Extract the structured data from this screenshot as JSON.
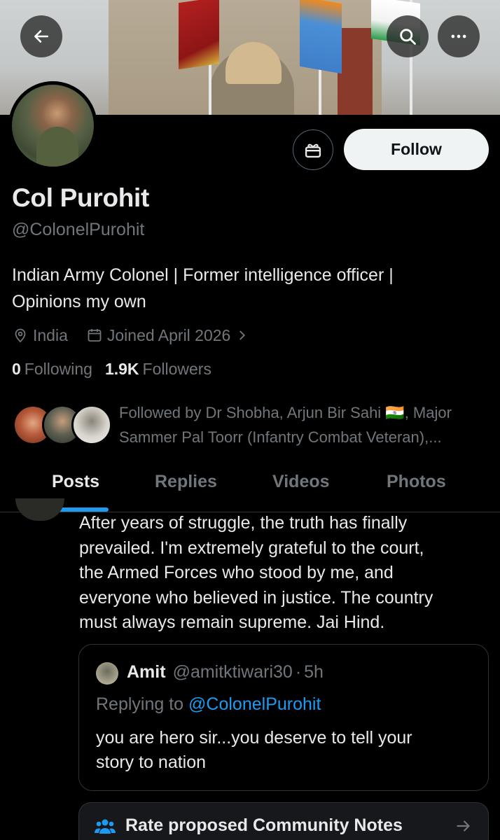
{
  "header": {
    "back_icon": "arrow-left-icon",
    "search_icon": "search-icon",
    "more_icon": "more-horizontal-icon"
  },
  "profile": {
    "name": "Col Purohit",
    "handle": "@ColonelPurohit",
    "bio_line1": "Indian Army Colonel | Former intelligence officer |",
    "bio_line2": "Opinions my own",
    "location": "India",
    "joined": "Joined April 2026",
    "following_count": "0",
    "following_label": "Following",
    "followers_count": "1.9K",
    "followers_label": "Followers",
    "follow_button": "Follow",
    "gift_icon": "gift-icon"
  },
  "followed_by": {
    "line1": "Followed by Dr Shobha, Arjun Bir Sahi 🇮🇳, Major",
    "line2": "Sammer Pal Toorr (Infantry Combat Veteran),..."
  },
  "tabs": [
    {
      "label": "Posts",
      "active": true
    },
    {
      "label": "Replies",
      "active": false
    },
    {
      "label": "Videos",
      "active": false
    },
    {
      "label": "Photos",
      "active": false
    }
  ],
  "post": {
    "text_lines": [
      "After years of struggle, the truth has finally",
      "prevailed. I'm extremely grateful to the court,",
      "the Armed Forces who stood by me, and",
      "everyone who believed in justice. The country",
      "must always remain supreme. Jai Hind."
    ]
  },
  "quote": {
    "name": "Amit",
    "handle": "@amitktiwari30",
    "separator": "·",
    "time": "5h",
    "replying_prefix": "Replying to",
    "replying_to": "@ColonelPurohit",
    "text_line1": "you are hero sir...you deserve to tell your",
    "text_line2": "story to nation"
  },
  "community_notes": {
    "label": "Rate proposed Community Notes"
  },
  "colors": {
    "accent": "#1d9bf0",
    "background": "#000000",
    "muted": "#71767b",
    "text": "#e7e9ea"
  }
}
